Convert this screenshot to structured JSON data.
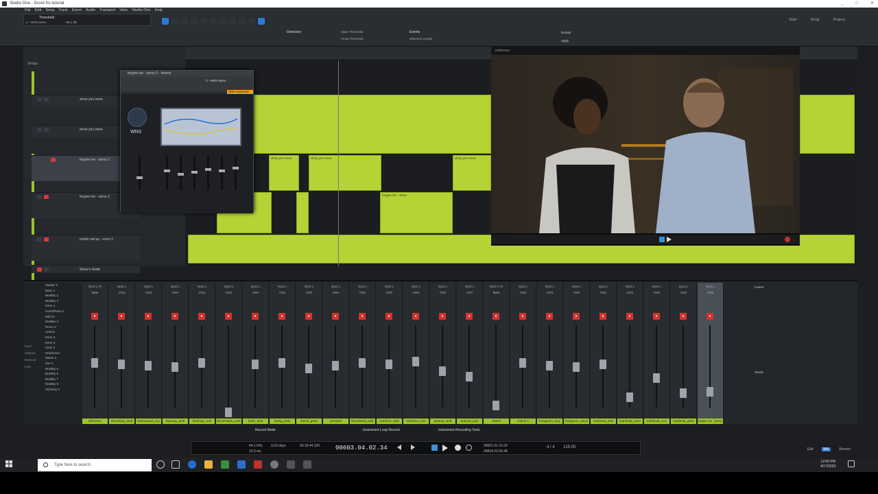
{
  "window": {
    "title": "Studio One - Score fro tutorial",
    "controls": [
      "_",
      "□",
      "✕"
    ]
  },
  "menu": [
    "File",
    "Edit",
    "Song",
    "Track",
    "Event",
    "Audio",
    "Transport",
    "View",
    "Studio One",
    "Help"
  ],
  "toolbar": {
    "track_name": "Threshold",
    "track_sub": "3 - WNS Mono",
    "track_db": "-58.4 dB",
    "detection_label": "Detection",
    "events_label": "Events",
    "open_threshold": "Open Threshold",
    "close_threshold": "Close Threshold",
    "minimum_length": "Minimum Length",
    "apply": "Apply",
    "default": "Default",
    "pages": [
      "Start",
      "Song",
      "Project"
    ]
  },
  "tracks": [
    {
      "name": "show you more",
      "sel": false
    },
    {
      "name": "show you more",
      "sel": false
    },
    {
      "name": "forgive me - jenny 2",
      "sel": true
    },
    {
      "name": "forgive me - steve 3",
      "sel": false
    },
    {
      "name": "martin sat up - room 2",
      "sel": false
    },
    {
      "name": "Steve's death",
      "sel": false
    }
  ],
  "tempo_label": "Tempo",
  "plugin": {
    "title": "forgive me - jenny 2 - Inserts",
    "sub": "3 - WNS Mono",
    "sidekey": "Side Keyboard",
    "brand": "WNS"
  },
  "video": {
    "title": "reference"
  },
  "mixer": {
    "list": [
      "Master X",
      "Bass 4",
      "Bradley 2",
      "Bradley 3",
      "Kenn 1",
      "GrandPiano 2",
      "Mid 03",
      "Bradley 3",
      "Room 2",
      "Antony",
      "Kenn 3",
      "Kenn 4",
      "Kenn 2",
      "Headroom",
      "Martin 2",
      "Sax 2",
      "Bradley 5",
      "Bradley 6",
      "Bradley 7",
      "Bradley 8",
      "Alchemy 2"
    ],
    "side_labels": [
      "Input",
      "Outputs",
      "External",
      "Instr."
    ],
    "channels": [
      {
        "in": "Input L+R",
        "vox": "Main",
        "name": "reference",
        "cap": 48
      },
      {
        "in": "Input L",
        "vox": "VOX",
        "name": "Woodstop_amb",
        "cap": 50
      },
      {
        "in": "Input L",
        "vox": "VOX",
        "name": "Grasswood_rmy",
        "cap": 52
      },
      {
        "in": "Input L",
        "vox": "VOX",
        "name": "Ramsay_amb",
        "cap": 54
      },
      {
        "in": "Input L",
        "vox": "VOX",
        "name": "Ramsay_cms",
        "cap": 48
      },
      {
        "in": "Input L",
        "vox": "VOX",
        "name": "Slowmotion_amb",
        "cap": 120
      },
      {
        "in": "Input L",
        "vox": "VOX",
        "name": "hamr_amb",
        "cap": 50
      },
      {
        "in": "Input L",
        "vox": "VOX",
        "name": "loving_amb",
        "cap": 48
      },
      {
        "in": "Input L",
        "vox": "VOX",
        "name": "hamm_gram",
        "cap": 56
      },
      {
        "in": "Input L",
        "vox": "VOX",
        "name": "jennytrai",
        "cap": 52
      },
      {
        "in": "Input L",
        "vox": "VOX",
        "name": "Woodward_amb",
        "cap": 48
      },
      {
        "in": "Input L",
        "vox": "VOX",
        "name": "entrance_amb",
        "cap": 50
      },
      {
        "in": "Input L",
        "vox": "VOX",
        "name": "entrance_cms",
        "cap": 46
      },
      {
        "in": "Input L",
        "vox": "VOX",
        "name": "antonal_amb",
        "cap": 60
      },
      {
        "in": "Input L",
        "vox": "VOX",
        "name": "antonal_pick",
        "cap": 68
      },
      {
        "in": "Input L+R",
        "vox": "Main",
        "name": "chanel",
        "cap": 110
      },
      {
        "in": "Input L",
        "vox": "VOX",
        "name": "chanel 1",
        "cap": 48
      },
      {
        "in": "Input L",
        "vox": "VOX",
        "name": "foregivem_amy",
        "cap": 52
      },
      {
        "in": "Input L",
        "vox": "VOX",
        "name": "foregivem_amy2",
        "cap": 54
      },
      {
        "in": "Input L",
        "vox": "VOX",
        "name": "martinsat_amb",
        "cap": 50
      },
      {
        "in": "Input L",
        "vox": "VOX",
        "name": "martinsat_room",
        "cap": 98
      },
      {
        "in": "Input L",
        "vox": "VOX",
        "name": "martinsat_cms",
        "cap": 70
      },
      {
        "in": "Input L",
        "vox": "VOX",
        "name": "martinsat_gram",
        "cap": 92
      },
      {
        "in": "Input L",
        "vox": "VOX",
        "name": "forgive me - jenny 2",
        "cap": 90,
        "sel": true
      }
    ],
    "inserts_label": "Inserts",
    "sends_label": "Sends"
  },
  "transport": {
    "record_mode": "Record Mode",
    "loop_record": "Instrument Loop Record",
    "recording_tools": "Instrument Recording Tools",
    "sample_rate": "44.1 kHz",
    "latency": "12.6 ms",
    "record_max": "0:20 days",
    "time_a": "00:18:44.320",
    "position": "00603.04.02.34",
    "loop_start": "00001.01.01.00",
    "loop_end": "00834.02.04.48",
    "signature": "4 / 4",
    "tempo": "125.00",
    "view_tabs": [
      "Edit",
      "Mix",
      "Browse"
    ]
  },
  "taskbar": {
    "search_placeholder": "Type here to search",
    "time": "12:09 PM",
    "date": "4/17/2020"
  }
}
